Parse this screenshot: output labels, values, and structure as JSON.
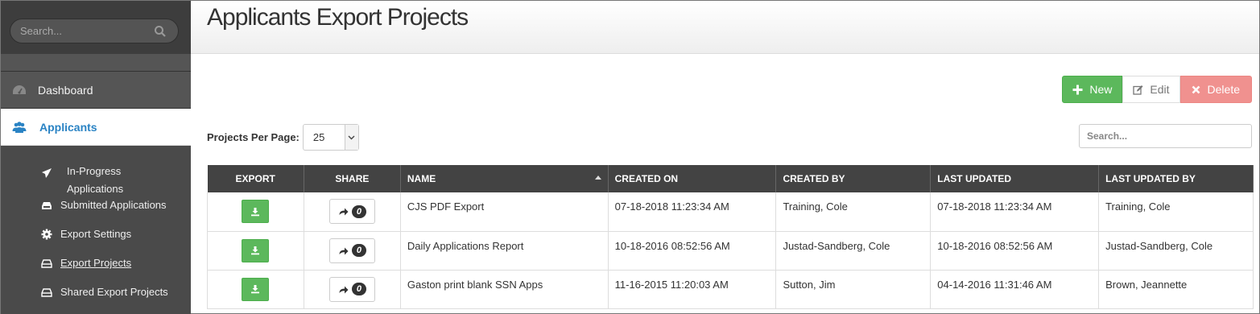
{
  "sidebar": {
    "search_placeholder": "Search...",
    "nav": [
      {
        "label": "Dashboard",
        "icon": "dashboard-icon"
      },
      {
        "label": "Applicants",
        "icon": "users-icon"
      }
    ],
    "subnav": [
      {
        "label": "In-Progress Applications",
        "icon": "paper-plane-icon"
      },
      {
        "label": "Submitted Applications",
        "icon": "inbox-icon"
      },
      {
        "label": "Export Settings",
        "icon": "gear-icon"
      },
      {
        "label": "Export Projects",
        "icon": "hdd-icon"
      },
      {
        "label": "Shared Export Projects",
        "icon": "hdd-icon"
      }
    ]
  },
  "header": {
    "title": "Applicants Export Projects"
  },
  "toolbar": {
    "new_label": "New",
    "edit_label": "Edit",
    "delete_label": "Delete"
  },
  "controls": {
    "per_page_label": "Projects Per Page:",
    "per_page_value": "25",
    "search_placeholder": "Search..."
  },
  "table": {
    "columns": [
      "EXPORT",
      "SHARE",
      "NAME",
      "CREATED ON",
      "CREATED BY",
      "LAST UPDATED",
      "LAST UPDATED BY"
    ],
    "rows": [
      {
        "share_count": "0",
        "name": "CJS PDF Export",
        "created_on": "07-18-2018 11:23:34 AM",
        "created_by": "Training, Cole",
        "last_updated": "07-18-2018 11:23:34 AM",
        "last_updated_by": "Training, Cole"
      },
      {
        "share_count": "0",
        "name": "Daily Applications Report",
        "created_on": "10-18-2016 08:52:56 AM",
        "created_by": "Justad-Sandberg, Cole",
        "last_updated": "10-18-2016 08:52:56 AM",
        "last_updated_by": "Justad-Sandberg, Cole"
      },
      {
        "share_count": "0",
        "name": "Gaston print blank SSN Apps",
        "created_on": "11-16-2015 11:20:03 AM",
        "created_by": "Sutton, Jim",
        "last_updated": "04-14-2016 11:31:46 AM",
        "last_updated_by": "Brown, Jeannette"
      }
    ]
  }
}
